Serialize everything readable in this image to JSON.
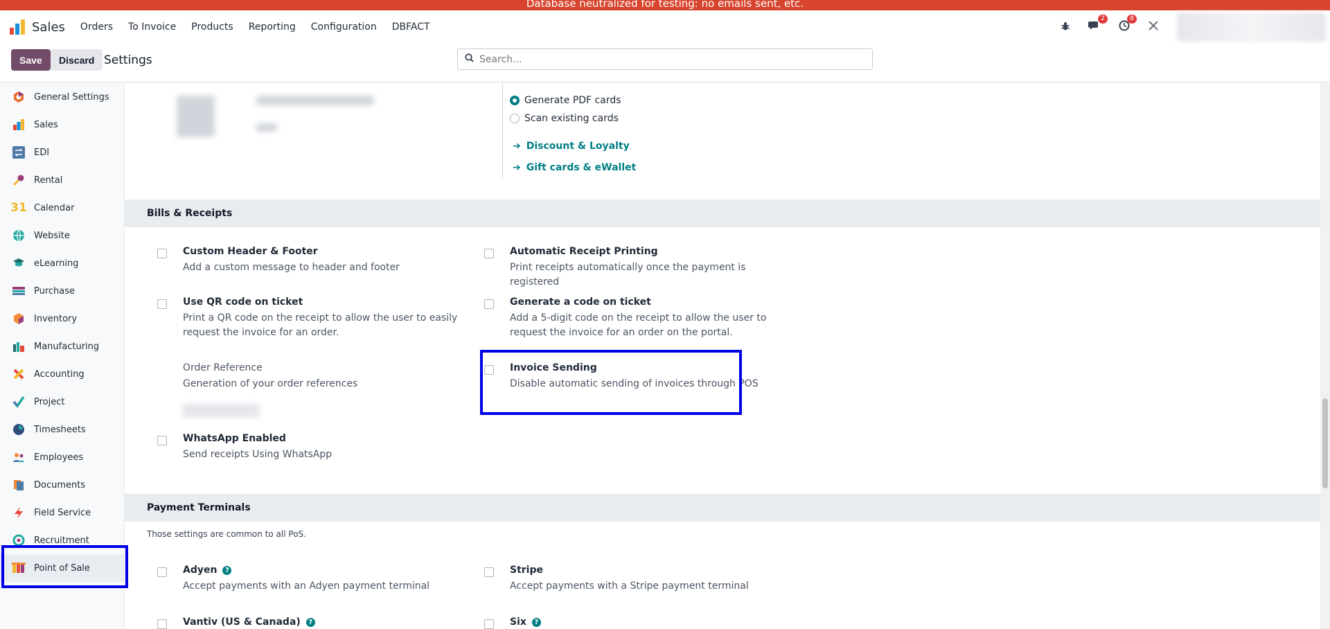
{
  "banner": {
    "text": "Database neutralized for testing: no emails sent, etc."
  },
  "navbar": {
    "app_name": "Sales",
    "menu": [
      "Orders",
      "To Invoice",
      "Products",
      "Reporting",
      "Configuration",
      "DBFACT"
    ],
    "messages_badge": "2",
    "activities_badge": "8"
  },
  "controlbar": {
    "save_label": "Save",
    "discard_label": "Discard",
    "title": "Settings",
    "search_placeholder": "Search..."
  },
  "sidebar": {
    "items": [
      {
        "label": "General Settings",
        "icon": "general-settings-icon"
      },
      {
        "label": "Sales",
        "icon": "sales-icon"
      },
      {
        "label": "EDI",
        "icon": "edi-icon"
      },
      {
        "label": "Rental",
        "icon": "rental-icon"
      },
      {
        "label": "Calendar",
        "icon": "calendar-icon"
      },
      {
        "label": "Website",
        "icon": "website-icon"
      },
      {
        "label": "eLearning",
        "icon": "elearning-icon"
      },
      {
        "label": "Purchase",
        "icon": "purchase-icon"
      },
      {
        "label": "Inventory",
        "icon": "inventory-icon"
      },
      {
        "label": "Manufacturing",
        "icon": "manufacturing-icon"
      },
      {
        "label": "Accounting",
        "icon": "accounting-icon"
      },
      {
        "label": "Project",
        "icon": "project-icon"
      },
      {
        "label": "Timesheets",
        "icon": "timesheets-icon"
      },
      {
        "label": "Employees",
        "icon": "employees-icon"
      },
      {
        "label": "Documents",
        "icon": "documents-icon"
      },
      {
        "label": "Field Service",
        "icon": "field-service-icon"
      },
      {
        "label": "Recruitment",
        "icon": "recruitment-icon"
      },
      {
        "label": "Point of Sale",
        "icon": "point-of-sale-icon"
      }
    ],
    "calendar_icon_text": "31"
  },
  "top_section": {
    "radio_generate": "Generate PDF cards",
    "radio_scan": "Scan existing cards",
    "link_discount": "Discount & Loyalty",
    "link_gift": "Gift cards & eWallet"
  },
  "bills": {
    "title": "Bills & Receipts",
    "custom_header": {
      "title": "Custom Header & Footer",
      "desc": "Add a custom message to header and footer"
    },
    "auto_print": {
      "title": "Automatic Receipt Printing",
      "desc": "Print receipts automatically once the payment is registered"
    },
    "qr_code": {
      "title": "Use QR code on ticket",
      "desc": "Print a QR code on the receipt to allow the user to easily request the invoice for an order."
    },
    "gen_code": {
      "title": "Generate a code on ticket",
      "desc": "Add a 5-digit code on the receipt to allow the user to request the invoice for an order on the portal."
    },
    "order_ref": {
      "title": "Order Reference",
      "desc": "Generation of your order references"
    },
    "invoice_sending": {
      "title": "Invoice Sending",
      "desc": "Disable automatic sending of invoices through POS"
    },
    "whatsapp": {
      "title": "WhatsApp Enabled",
      "desc": "Send receipts Using WhatsApp"
    }
  },
  "payment": {
    "title": "Payment Terminals",
    "note": "Those settings are common to all PoS.",
    "adyen": {
      "title": "Adyen",
      "desc": "Accept payments with an Adyen payment terminal"
    },
    "stripe": {
      "title": "Stripe",
      "desc": "Accept payments with a Stripe payment terminal"
    },
    "vantiv": {
      "title": "Vantiv (US & Canada)"
    },
    "six": {
      "title": "Six"
    },
    "help_glyph": "?"
  },
  "colors": {
    "accent": "#017e84",
    "primary": "#714b67",
    "highlight": "#0000e6",
    "banner": "#d7452e"
  }
}
